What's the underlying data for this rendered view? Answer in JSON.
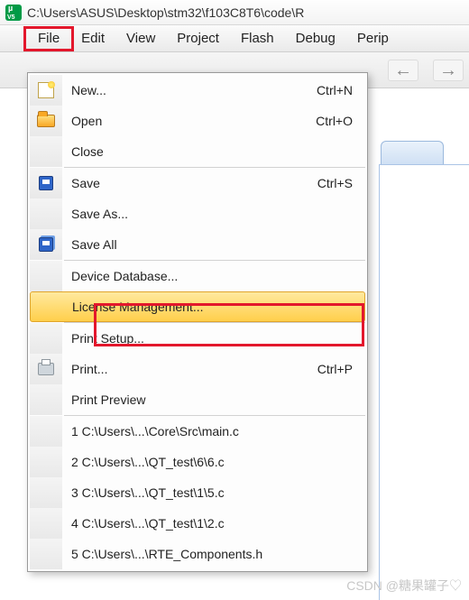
{
  "title_path": "C:\\Users\\ASUS\\Desktop\\stm32\\f103C8T6\\code\\R",
  "menubar": {
    "file": "File",
    "edit": "Edit",
    "view": "View",
    "project": "Project",
    "flash": "Flash",
    "debug": "Debug",
    "peripherals": "Perip"
  },
  "file_menu": {
    "new": {
      "label": "New...",
      "shortcut": "Ctrl+N"
    },
    "open": {
      "label": "Open",
      "shortcut": "Ctrl+O"
    },
    "close": {
      "label": "Close",
      "shortcut": ""
    },
    "save": {
      "label": "Save",
      "shortcut": "Ctrl+S"
    },
    "save_as": {
      "label": "Save As...",
      "shortcut": ""
    },
    "save_all": {
      "label": "Save All",
      "shortcut": ""
    },
    "device_db": {
      "label": "Device Database...",
      "shortcut": ""
    },
    "license": {
      "label": "License Management...",
      "shortcut": ""
    },
    "print_setup": {
      "label": "Print Setup...",
      "shortcut": ""
    },
    "print": {
      "label": "Print...",
      "shortcut": "Ctrl+P"
    },
    "print_preview": {
      "label": "Print Preview",
      "shortcut": ""
    },
    "recent1": {
      "label": "1 C:\\Users\\...\\Core\\Src\\main.c"
    },
    "recent2": {
      "label": "2 C:\\Users\\...\\QT_test\\6\\6.c"
    },
    "recent3": {
      "label": "3 C:\\Users\\...\\QT_test\\1\\5.c"
    },
    "recent4": {
      "label": "4 C:\\Users\\...\\QT_test\\1\\2.c"
    },
    "recent5": {
      "label": "5 C:\\Users\\...\\RTE_Components.h"
    }
  },
  "watermark": "CSDN @糖果罐子♡"
}
